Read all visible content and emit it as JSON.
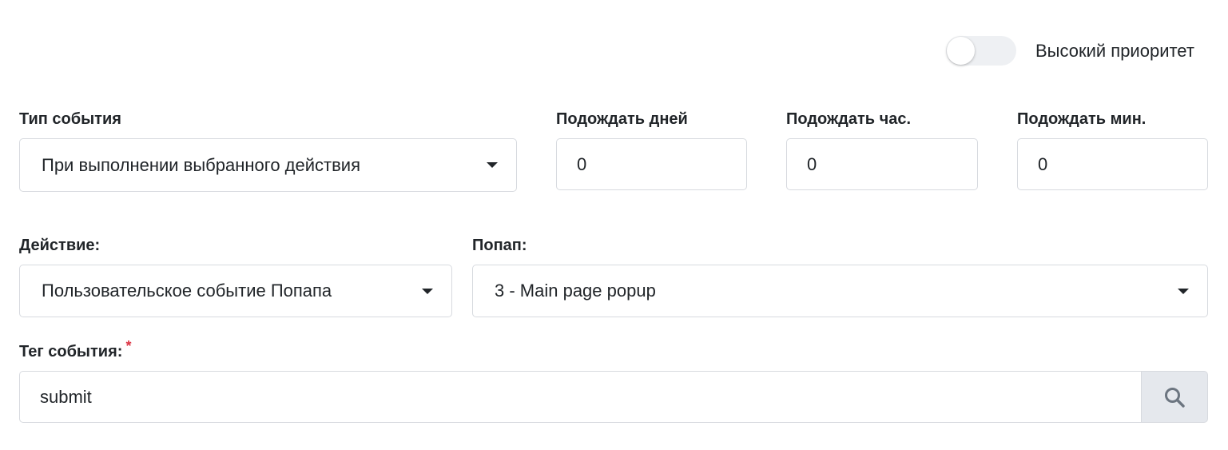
{
  "priority": {
    "label": "Высокий приоритет",
    "enabled": false
  },
  "event_type": {
    "label": "Тип события",
    "value": "При выполнении выбранного действия"
  },
  "wait_days": {
    "label": "Подождать дней",
    "value": "0"
  },
  "wait_hours": {
    "label": "Подождать час.",
    "value": "0"
  },
  "wait_minutes": {
    "label": "Подождать мин.",
    "value": "0"
  },
  "action": {
    "label": "Действие:",
    "value": "Пользовательское событие Попапа"
  },
  "popup": {
    "label": "Попап:",
    "value": "3 - Main page popup"
  },
  "event_tag": {
    "label": "Тег события:",
    "required_mark": "*",
    "value": "submit"
  },
  "icons": {
    "search": "search-icon",
    "caret": "caret-down-icon"
  },
  "colors": {
    "border": "#d7dadf",
    "required": "#dc3545",
    "toggle_track": "#eef0f3",
    "search_button_bg": "#e5e8ed"
  }
}
